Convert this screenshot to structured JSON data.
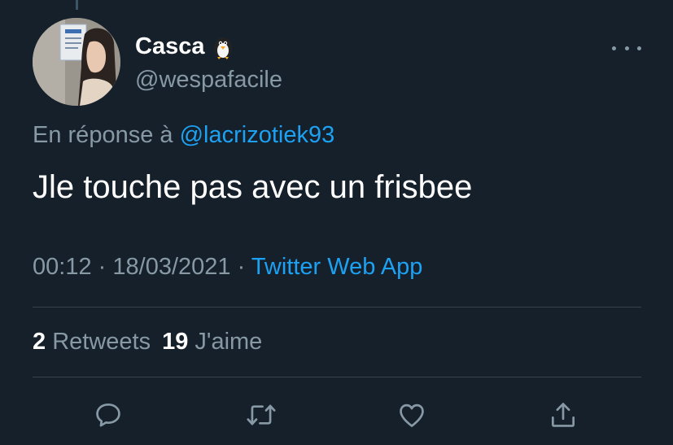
{
  "tweet": {
    "author": {
      "display_name": "Casca",
      "handle": "@wespafacile",
      "emoji_icon": "penguin-emoji-icon"
    },
    "reply_context": {
      "prefix": "En réponse à",
      "mention": "@lacrizotiek93"
    },
    "text": "Jle touche pas avec un frisbee",
    "meta": {
      "time": "00:12",
      "separator": "·",
      "date": "18/03/2021",
      "source": "Twitter Web App"
    },
    "stats": {
      "retweets_count": "2",
      "retweets_label": "Retweets",
      "likes_count": "19",
      "likes_label": "J'aime"
    }
  },
  "actions": {
    "icons": [
      "reply-icon",
      "retweet-icon",
      "like-icon",
      "share-icon"
    ]
  },
  "colors": {
    "background": "#15202b",
    "link": "#1da1f2",
    "secondary_text": "#8899a6",
    "divider": "#38444d"
  }
}
